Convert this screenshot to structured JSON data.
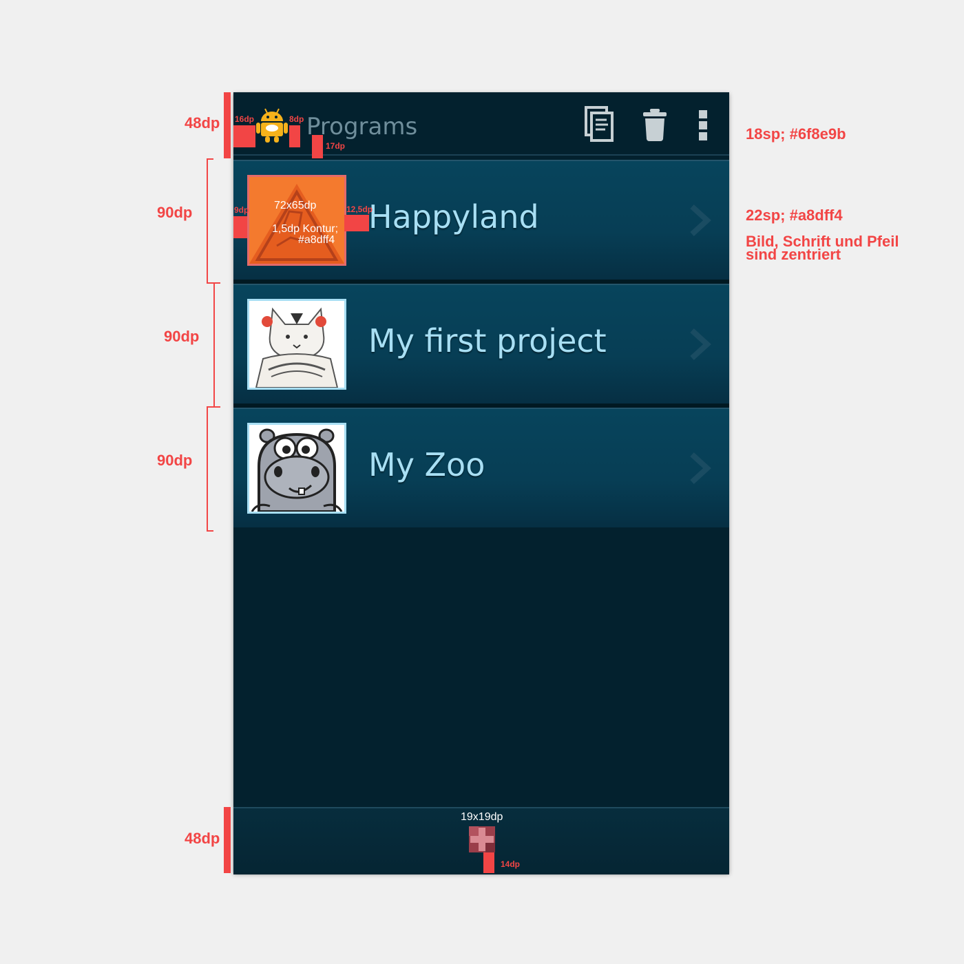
{
  "actionbar": {
    "title": "Programs",
    "buttons": {
      "copy": "copy-icon",
      "delete": "trash-icon",
      "overflow": "overflow-menu-icon"
    },
    "title_color": "#6f8e9b"
  },
  "programs": [
    {
      "title": "Happyland"
    },
    {
      "title": "My first project"
    },
    {
      "title": "My Zoo"
    }
  ],
  "annotations": {
    "actionbar_height": "48dp",
    "icon_left": "16dp",
    "icon_right": "8dp",
    "icon_bottom": "17dp",
    "title_spec": "18sp; #6f8e9b",
    "row_height_1": "90dp",
    "row_height_2": "90dp",
    "row_height_3": "90dp",
    "thumb_left": "9dp",
    "thumb_size": "72x65dp",
    "thumb_stroke_1": "1,5dp Kontur;",
    "thumb_stroke_2": "#a8dff4",
    "thumb_right": "12,5dp",
    "row_title_spec": "22sp; #a8dff4",
    "centered_note_1": "Bild, Schrift und Pfeil",
    "centered_note_2": "sind zentriert",
    "bottombar_height": "48dp",
    "add_size": "19x19dp",
    "add_bottom": "14dp"
  },
  "colors": {
    "background": "#03212e",
    "row": "#07445c",
    "title": "#a8dff4",
    "annotation": "#f24545"
  }
}
